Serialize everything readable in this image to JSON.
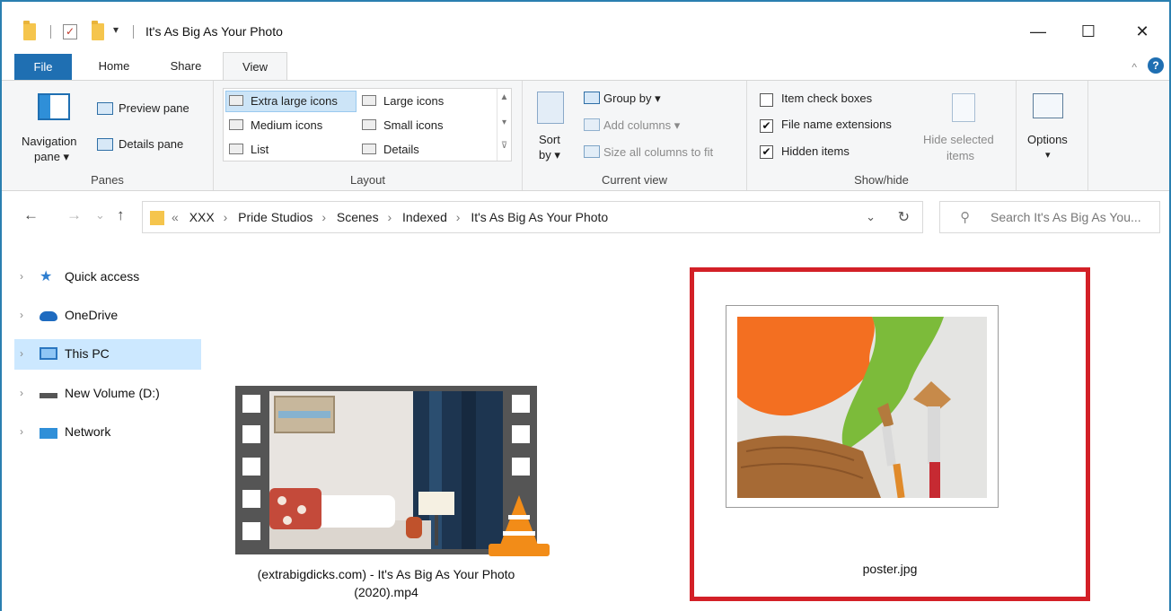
{
  "window": {
    "title": "It's As Big As Your Photo",
    "controls": {
      "minimize": "—",
      "maximize": "☐",
      "close": "✕"
    }
  },
  "quick_access": {
    "dropdown": "▾"
  },
  "ribbon": {
    "tabs": [
      {
        "label": "File"
      },
      {
        "label": "Home"
      },
      {
        "label": "Share"
      },
      {
        "label": "View"
      }
    ],
    "active_tab": "View",
    "collapse_glyph": "^",
    "help_glyph": "?",
    "panes": {
      "navigation_pane": "Navigation",
      "navigation_pane_2": "pane ▾",
      "preview_pane": "Preview pane",
      "details_pane": "Details pane",
      "label": "Panes"
    },
    "layout": {
      "options": [
        "Extra large icons",
        "Large icons",
        "Medium icons",
        "Small icons",
        "List",
        "Details"
      ],
      "selected": "Extra large icons",
      "scroll_up": "▲",
      "scroll_down": "▾",
      "scroll_more": "⊽",
      "label": "Layout"
    },
    "current_view": {
      "sort_by": "Sort",
      "sort_by_2": "by ▾",
      "group_by": "Group by ▾",
      "add_columns": "Add columns ▾",
      "size_columns": "Size all columns to fit",
      "label": "Current view"
    },
    "show_hide": {
      "item_check_boxes": {
        "label": "Item check boxes",
        "checked": false
      },
      "file_name_extensions": {
        "label": "File name extensions",
        "checked": true
      },
      "hidden_items": {
        "label": "Hidden items",
        "checked": true
      },
      "hide_selected": "Hide selected",
      "hide_selected_2": "items",
      "check_mark": "✔",
      "label": "Show/hide"
    },
    "options": {
      "label": "Options",
      "dropdown": "▾"
    }
  },
  "navigation": {
    "back": "←",
    "forward": "→",
    "recent": "⌄",
    "up": "↑",
    "overflow": "«",
    "breadcrumbs": [
      "XXX",
      "Pride Studios",
      "Scenes",
      "Indexed",
      "It's As Big As Your Photo"
    ],
    "crumb_separator": "›",
    "dropdown": "⌄",
    "refresh": "↻",
    "search_placeholder": "Search It's As Big As You..."
  },
  "sidebar": {
    "items": [
      {
        "label": "Quick access",
        "selected": false
      },
      {
        "label": "OneDrive",
        "selected": false
      },
      {
        "label": "This PC",
        "selected": true
      },
      {
        "label": "New Volume (D:)",
        "selected": false
      },
      {
        "label": "Network",
        "selected": false
      }
    ],
    "chevron": "›"
  },
  "files": [
    {
      "name": "(extrabigdicks.com) - It's As Big As Your Photo",
      "name_line2": "(2020).mp4",
      "type": "video"
    },
    {
      "name": "poster.jpg",
      "type": "image",
      "highlighted": true
    }
  ],
  "colors": {
    "accent": "#1f6fb2",
    "highlight_border": "#d32027",
    "selection": "#cce8ff"
  }
}
